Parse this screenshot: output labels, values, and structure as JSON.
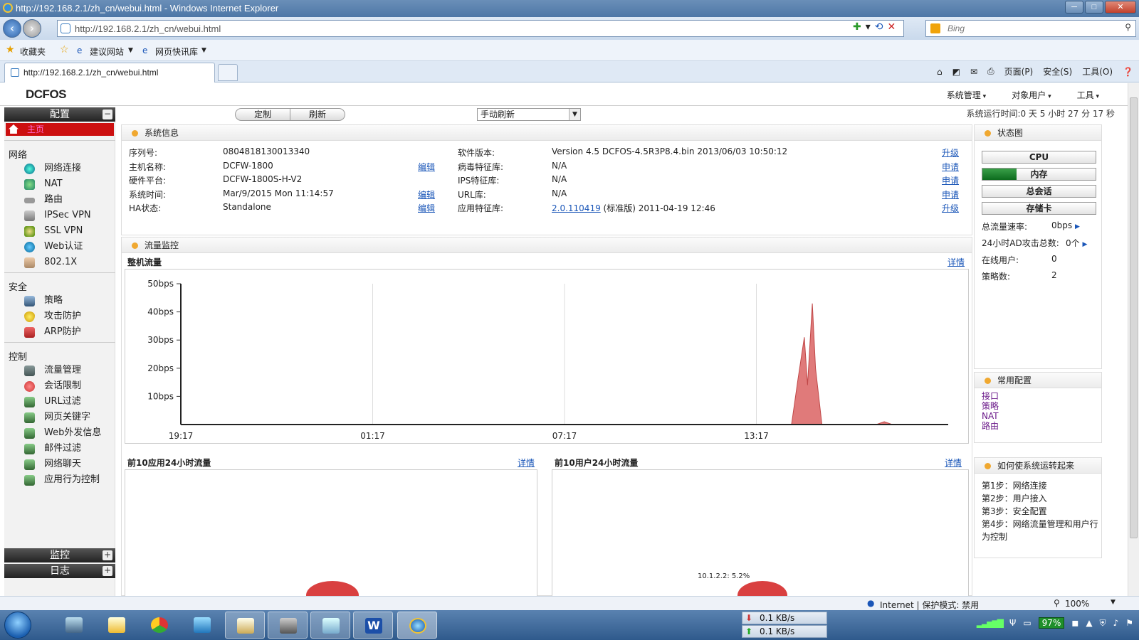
{
  "window": {
    "title": "http://192.168.2.1/zh_cn/webui.html - Windows Internet Explorer"
  },
  "address_bar": {
    "url": "http://192.168.2.1/zh_cn/webui.html",
    "search_placeholder": "Bing"
  },
  "favorites_bar": {
    "favorites": "收藏夹",
    "suggested_sites": "建议网站",
    "web_slice": "网页快讯库"
  },
  "tab": {
    "title": "http://192.168.2.1/zh_cn/webui.html"
  },
  "command_bar": {
    "page": "页面(P)",
    "safety": "安全(S)",
    "tools": "工具(O)"
  },
  "app": {
    "logo": "DCFOS",
    "menu": [
      "系统管理",
      "对象用户",
      "工具"
    ]
  },
  "sidebar": {
    "config_header": "配置",
    "home": "主页",
    "groups": [
      {
        "name": "网络",
        "items": [
          "网络连接",
          "NAT",
          "路由",
          "IPSec VPN",
          "SSL VPN",
          "Web认证",
          "802.1X"
        ]
      },
      {
        "name": "安全",
        "items": [
          "策略",
          "攻击防护",
          "ARP防护"
        ]
      },
      {
        "name": "控制",
        "items": [
          "流量管理",
          "会话限制",
          "URL过滤",
          "网页关键字",
          "Web外发信息",
          "邮件过滤",
          "网络聊天",
          "应用行为控制"
        ]
      }
    ],
    "monitor_header": "监控",
    "log_header": "日志"
  },
  "toolbar": {
    "customize": "定制",
    "refresh": "刷新",
    "refresh_mode": "手动刷新"
  },
  "uptime": "系统运行时间:0 天 5 小时 27 分 17 秒",
  "sysinfo": {
    "title": "系统信息",
    "rows_left": [
      {
        "label": "序列号:",
        "value": "0804818130013340",
        "link": ""
      },
      {
        "label": "主机名称:",
        "value": "DCFW-1800",
        "link": "编辑"
      },
      {
        "label": "硬件平台:",
        "value": "DCFW-1800S-H-V2",
        "link": ""
      },
      {
        "label": "系统时间:",
        "value": "Mar/9/2015  Mon  11:14:57",
        "link": "编辑"
      },
      {
        "label": "HA状态:",
        "value": "Standalone",
        "link": "编辑"
      }
    ],
    "rows_right": [
      {
        "label": "软件版本:",
        "value": "Version 4.5 DCFOS-4.5R3P8.4.bin 2013/06/03 10:50:12",
        "link": "升级"
      },
      {
        "label": "病毒特征库:",
        "value": "N/A",
        "link": "申请"
      },
      {
        "label": "IPS特征库:",
        "value": "N/A",
        "link": "申请"
      },
      {
        "label": "URL库:",
        "value": "N/A",
        "link": "申请"
      },
      {
        "label": "应用特征库:",
        "value_link": "2.0.110419",
        "value": " (标准版) 2011-04-19 12:46",
        "link": "升级"
      }
    ]
  },
  "traffic": {
    "title": "流量监控",
    "whole_title": "整机流量",
    "detail": "详情",
    "top_apps_title": "前10应用24小时流量",
    "top_users_title": "前10用户24小时流量",
    "pie_label": "10.1.2.2: 5.2%"
  },
  "chart_data": {
    "type": "area",
    "title": "整机流量",
    "y_ticks": [
      "10bps",
      "20bps",
      "30bps",
      "40bps",
      "50bps"
    ],
    "ylim": [
      0,
      50
    ],
    "x_ticks": [
      "19:17",
      "01:17",
      "07:17",
      "13:17"
    ],
    "xlim_hours": [
      0,
      24
    ],
    "series": [
      {
        "x": [
          0,
          19.1,
          19.3,
          19.5,
          19.6,
          19.75,
          19.85,
          20.05,
          20.2,
          21.75,
          22.0,
          22.25,
          24
        ],
        "y": [
          0,
          0,
          16,
          31,
          14,
          43,
          20,
          0,
          0,
          0,
          1,
          0,
          0
        ]
      }
    ],
    "color": "#e07a7a"
  },
  "status_panel": {
    "title": "状态图",
    "cpu": "CPU",
    "memory": "内存",
    "memory_usage": 0.3,
    "sessions": "总会话",
    "storage": "存储卡",
    "stats": [
      {
        "label": "总流量速率:",
        "value": "0bps"
      },
      {
        "label": "24小时AD攻击总数:",
        "value": "0个"
      },
      {
        "label": "在线用户:",
        "value": "0"
      },
      {
        "label": "策略数:",
        "value": "2"
      }
    ]
  },
  "common_config": {
    "title": "常用配置",
    "links": [
      "接口",
      "策略",
      "NAT",
      "路由"
    ]
  },
  "howto": {
    "title": "如何使系统运转起来",
    "steps": [
      "第1步：网络连接",
      "第2步：用户接入",
      "第3步：安全配置",
      "第4步：网络流量管理和用户行为控制"
    ]
  },
  "statusbar": {
    "zone": "Internet | 保护模式: 禁用",
    "zoom": "100%"
  },
  "taskbar": {
    "down_speed": "0.1 KB/s",
    "up_speed": "0.1 KB/s",
    "battery": "97%"
  }
}
